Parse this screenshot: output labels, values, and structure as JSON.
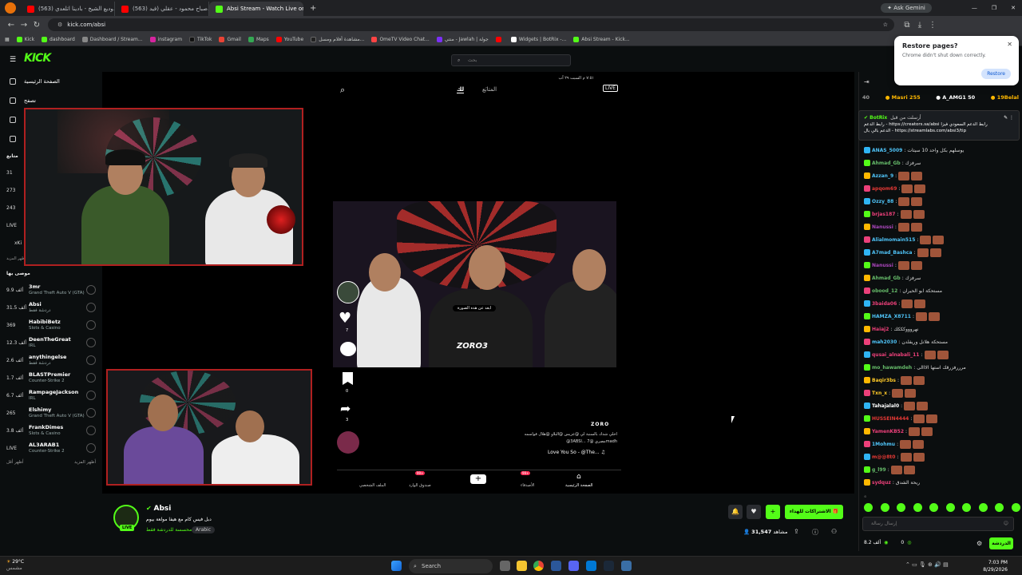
{
  "browser": {
    "tabs": [
      {
        "title": "(563) وديع الشيخ - بادينا اتلعدي...",
        "color": "#ff0000",
        "active": false
      },
      {
        "title": "(563) صباح محمود - عقلي (فيد...",
        "color": "#ff0000",
        "active": false
      },
      {
        "title": "Absi Stream - Watch Live on...",
        "color": "#53fc18",
        "active": true
      }
    ],
    "new_tab": "+",
    "url": "kick.com/absi",
    "gemini": "Ask Gemini",
    "bookmarks": [
      "Kick",
      "dashboard",
      "Dashboard / Stream...",
      "instagram",
      "TikTok",
      "Gmail",
      "Maps",
      "YouTube",
      "مشاهدة أفلام ومسل...",
      "OmeTV Video Chat...",
      "منتي - Jawlah | جولة",
      "",
      "Widgets | BotRix -...",
      "Absi Stream - Kick..."
    ]
  },
  "restore_popup": {
    "title": "Restore pages?",
    "subtitle": "Chrome didn't shut down correctly.",
    "button": "Restore",
    "close": "✕"
  },
  "kick": {
    "logo": "KICK",
    "search_placeholder": "بحث",
    "sidebar": {
      "nav": [
        "الصفحة الرئيسية",
        "تصفح",
        "",
        ""
      ],
      "following_title": "متابع",
      "following_counts": [
        "31",
        "273",
        "243",
        "LIVE",
        "xKi"
      ],
      "show_more_top": "أظهر المزيد",
      "recommended_title": "موصى بها",
      "channels": [
        {
          "count": "9.9 ألف",
          "name": "3mr",
          "category": "Grand Theft Auto V (GTA)"
        },
        {
          "count": "31.5 ألف",
          "name": "Absi",
          "category": "دردشة فقط"
        },
        {
          "count": "369",
          "name": "HabibiBetz",
          "category": "Slots & Casino"
        },
        {
          "count": "12.3 ألف",
          "name": "DeenTheGreat",
          "category": "IRL"
        },
        {
          "count": "2.6 ألف",
          "name": "anythingelse",
          "category": "دردشة فقط"
        },
        {
          "count": "1.7 ألف",
          "name": "BLASTPremier",
          "category": "Counter-Strike 2"
        },
        {
          "count": "6.7 ألف",
          "name": "RampageJackson",
          "category": "IRL"
        },
        {
          "count": "265",
          "name": "Elshimy",
          "category": "Grand Theft Auto V (GTA)"
        },
        {
          "count": "3.8 ألف",
          "name": "FrankDimes",
          "category": "Slots & Casino"
        },
        {
          "count": "LIVE",
          "name": "AL3ARAB1",
          "category": "Counter-Strike 2"
        }
      ],
      "show_more": "أظهر المزيد",
      "show_less": "أظهر أقل"
    },
    "video": {
      "phone_status": "٧:٥١ م السبت ٢٩ آب",
      "tabs": [
        "لك",
        "المتابَع"
      ],
      "live": "LIVE",
      "clip_caption": "ZORO3",
      "bubble": "ابعد عن هذه الصورة",
      "likes": "7",
      "comments": "",
      "saves": "0",
      "shares": "3",
      "author": "ZORO",
      "desc1": "اخلي شدك بالسنبة لي @عزيس @البلاو @هلال قواسمه",
      "desc2": "@3ABSI... مصري @7madh",
      "music": "Love You So - @The...",
      "bottom_nav": [
        "الملف الشخصي",
        "صندوق الوارد",
        "",
        "الأصدقاء",
        "الصفحة الرئيسية"
      ],
      "badge_99": "99+"
    },
    "stream": {
      "name": "Absi",
      "title": "دبل فيس كام مع هيفا مولعة بيوم",
      "category": "محسسة للدردشة فقط",
      "language": "Arabic",
      "live_badge": "LIVE",
      "viewers": "31,547",
      "viewers_label": "مشاهد",
      "subscribe": "الاشتراكات للهداء 🎁"
    },
    "chat": {
      "counts": [
        {
          "n": "40",
          "c": "#999"
        },
        {
          "n": "Masri 255",
          "c": "#ffb800"
        },
        {
          "n": "A_AMG1 50",
          "c": "#fff"
        },
        {
          "n": "19Belal",
          "c": "#ffb800"
        }
      ],
      "pinned_user": "BotRix",
      "pinned_by": "أرسلت من قبل",
      "pinned_line1": "رابط الدعم - https://creators.sa/absi رابط الدعم السعودي فيزا",
      "pinned_line2": "الدعم بالي بال - https://streamlabs.com/absi3/tip",
      "messages": [
        {
          "user": "ANAS_5009",
          "color": "#4fc3f7",
          "text": "يوسلهم بكل واحد 10 سيتات"
        },
        {
          "user": "Ahmad_Gb",
          "color": "#66bb6a",
          "text": "سرفزك"
        },
        {
          "user": "Azzan_9",
          "color": "#4fc3f7",
          "text": ""
        },
        {
          "user": "apqom69",
          "color": "#e53935",
          "text": ""
        },
        {
          "user": "Ozzy_88",
          "color": "#4fc3f7",
          "text": ""
        },
        {
          "user": "brjas187",
          "color": "#ec407a",
          "text": ""
        },
        {
          "user": "Nanussi",
          "color": "#ab47bc",
          "text": ""
        },
        {
          "user": "Alialmomain515",
          "color": "#4fc3f7",
          "text": ""
        },
        {
          "user": "A7mad_Bashca",
          "color": "#4fc3f7",
          "text": ""
        },
        {
          "user": "Nanussi",
          "color": "#ab47bc",
          "text": ""
        },
        {
          "user": "Ahmad_Gb",
          "color": "#66bb6a",
          "text": "سرفزك"
        },
        {
          "user": "obood_12",
          "color": "#66bb6a",
          "text": "مستحكة ابو الحيران"
        },
        {
          "user": "3baida06",
          "color": "#ec407a",
          "text": ""
        },
        {
          "user": "HAMZA_X8711",
          "color": "#4fc3f7",
          "text": ""
        },
        {
          "user": "Haiaj2",
          "color": "#ec407a",
          "text": "نهروووكككك"
        },
        {
          "user": "mah2030",
          "color": "#4fc3f7",
          "text": "مستحكة هلانل وريفلدن"
        },
        {
          "user": "qusai_alnabali_11",
          "color": "#ec407a",
          "text": ""
        },
        {
          "user": "mo_hawamdeh",
          "color": "#66bb6a",
          "text": "مرررفزرقك استها الااالى"
        },
        {
          "user": "Baqir3bs",
          "color": "#ffca28",
          "text": ""
        },
        {
          "user": "Txn_x",
          "color": "#ffca28",
          "text": ""
        },
        {
          "user": "Tahajalal0",
          "color": "#fff",
          "text": ""
        },
        {
          "user": "HUSSEIN4444",
          "color": "#e53935",
          "text": ""
        },
        {
          "user": "YamenKB52",
          "color": "#ec407a",
          "text": ""
        },
        {
          "user": "1Mohmu",
          "color": "#4fc3f7",
          "text": ""
        },
        {
          "user": "m@@8t0",
          "color": "#e53935",
          "text": ""
        },
        {
          "user": "g_l99",
          "color": "#66bb6a",
          "text": ""
        },
        {
          "user": "sydquz",
          "color": "#ec407a",
          "text": "ريحة الشدق"
        }
      ],
      "input_placeholder": "إرسال رسالة",
      "send": "الدردشة",
      "points": "8.2 ألف",
      "zero": "0"
    }
  },
  "taskbar": {
    "weather_temp": "29°C",
    "weather_desc": "مشمس",
    "search": "Search",
    "time": "7:03 PM",
    "date": "8/29/2026"
  }
}
